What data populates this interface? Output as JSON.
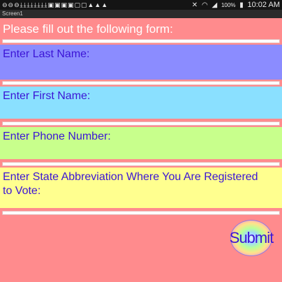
{
  "status_bar": {
    "notification_icons": "⊖⊖⊖⤓⤓⤓⤓⤓⤓⤓⤓▣▣▣▣▢▢▲▲▲",
    "battery": "100%",
    "time": "10:02 AM"
  },
  "window": {
    "title": "Screen1"
  },
  "form": {
    "intro": "Please fill out the following form:",
    "last_name_label": "Enter Last Name:",
    "first_name_label": "Enter First Name:",
    "phone_label": "Enter Phone Number:",
    "state_label": "Enter State Abbreviation Where You Are Registered to Vote:",
    "submit_label": "Submit"
  },
  "colors": {
    "background": "#ff8b8d",
    "last_name_panel": "#8b8cff",
    "first_name_panel": "#8ae0ff",
    "phone_panel": "#c8ff8c",
    "state_panel": "#ffff8f",
    "label_text": "#3b14d6"
  }
}
